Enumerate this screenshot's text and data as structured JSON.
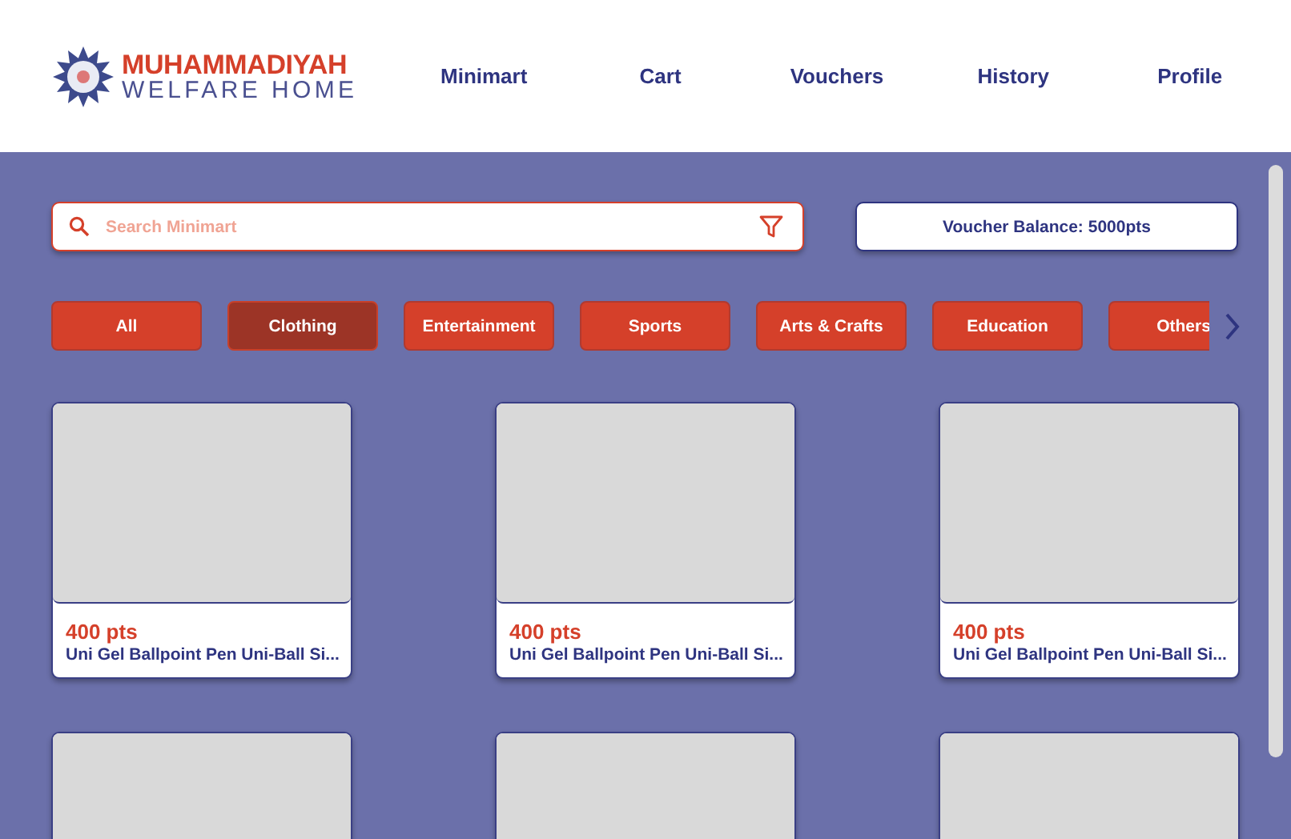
{
  "logo": {
    "line_1": "MUHAMMADIYAH",
    "line_2": "WELFARE HOME"
  },
  "nav": [
    {
      "label": "Minimart"
    },
    {
      "label": "Cart"
    },
    {
      "label": "Vouchers"
    },
    {
      "label": "History"
    },
    {
      "label": "Profile"
    }
  ],
  "search": {
    "placeholder": "Search Minimart"
  },
  "voucher_balance": "Voucher Balance: 5000pts",
  "categories": [
    {
      "label": "All",
      "selected": false
    },
    {
      "label": "Clothing",
      "selected": true
    },
    {
      "label": "Entertainment",
      "selected": false
    },
    {
      "label": "Sports",
      "selected": false
    },
    {
      "label": "Arts & Crafts",
      "selected": false
    },
    {
      "label": "Education",
      "selected": false
    },
    {
      "label": "Others",
      "selected": false
    }
  ],
  "products": [
    {
      "kind": "full",
      "price": "400 pts",
      "name": "Uni Gel Ballpoint Pen Uni-Ball Si..."
    },
    {
      "kind": "full",
      "price": "400 pts",
      "name": "Uni Gel Ballpoint Pen Uni-Ball Si..."
    },
    {
      "kind": "full",
      "price": "400 pts",
      "name": "Uni Gel Ballpoint Pen Uni-Ball Si..."
    },
    {
      "kind": "cut-off"
    },
    {
      "kind": "cut-off"
    },
    {
      "kind": "cut-off"
    }
  ]
}
